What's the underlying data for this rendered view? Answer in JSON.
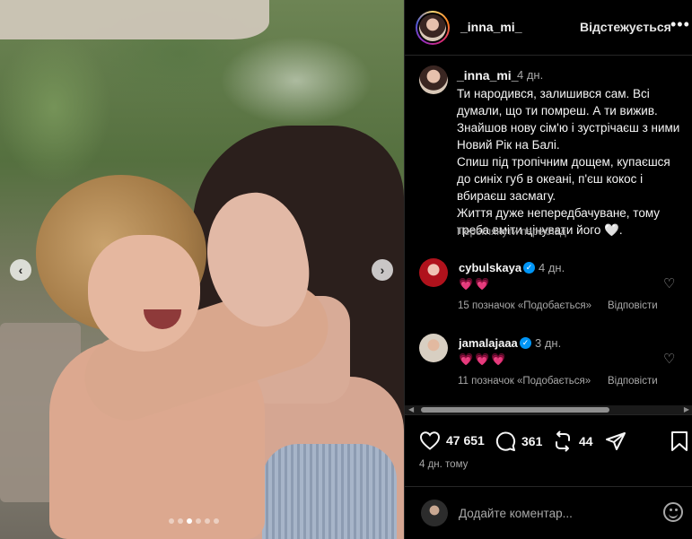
{
  "photo": {
    "alt_icons": {
      "prev": "chevron-left-icon",
      "next": "chevron-right-icon"
    },
    "carousel": {
      "total": 6,
      "active": 2
    }
  },
  "header": {
    "username": "_inna_mi_",
    "follow_status": "Відстежується",
    "more_icon": "more-horizontal-icon"
  },
  "caption": {
    "username": "_inna_mi_",
    "time": "4 дн.",
    "lines": [
      "Ти народився, залишився сам. Всі думали, що ти помреш. А ти вижив. Знайшов нову сім'ю і зустрічаєш з ними Новий Рік на Балі.",
      "Спиш під тропічним дощем, купаєшся до синіх губ в океані, п'єш кокос і вбираєш засмагу.",
      "Життя дуже непередбачуване, тому треба вміти цінувати його 🤍."
    ],
    "translate": "Переглянути переклад"
  },
  "comments": [
    {
      "username": "cybulskaya",
      "verified": true,
      "time": "4 дн.",
      "text": "💗💗",
      "likes": "15 позначок «Подобається»",
      "reply": "Відповісти"
    },
    {
      "username": "jamalajaaa",
      "verified": true,
      "time": "3 дн.",
      "text": "💗💗💗",
      "likes": "11 позначок «Подобається»",
      "reply": "Відповісти"
    }
  ],
  "actions": {
    "likes": "47 651",
    "comments": "361",
    "reposts": "44",
    "post_time": "4 дн. тому"
  },
  "add_comment": {
    "placeholder": "Додайте коментар..."
  },
  "colors": {
    "verified": "#0095f6",
    "heart": "#ff3040",
    "secondary_text": "#a8a8a8"
  }
}
